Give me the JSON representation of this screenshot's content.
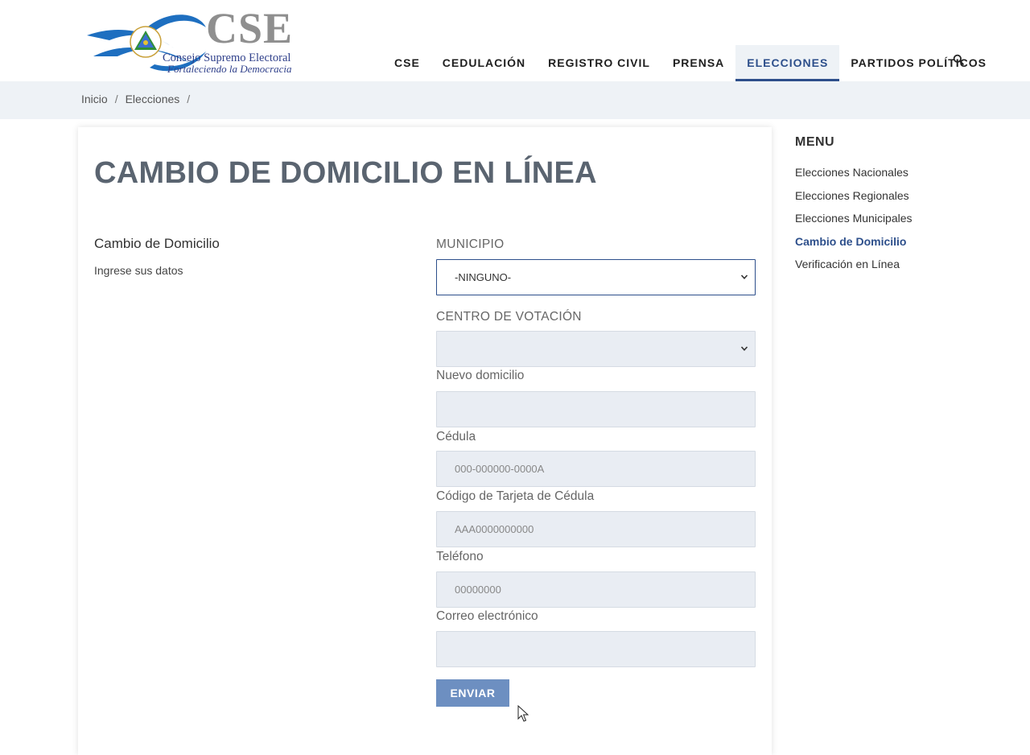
{
  "logo": {
    "title": "CSE",
    "subtitle": "Consejo Supremo Electoral",
    "tagline": "Fortaleciendo la Democracia"
  },
  "nav": {
    "items": [
      {
        "label": "CSE"
      },
      {
        "label": "CEDULACIÓN"
      },
      {
        "label": "REGISTRO CIVIL"
      },
      {
        "label": "PRENSA"
      },
      {
        "label": "ELECCIONES"
      },
      {
        "label": "PARTIDOS POLÍTICOS"
      }
    ],
    "active": "ELECCIONES",
    "search_icon": "search-icon"
  },
  "breadcrumb": {
    "items": [
      "Inicio",
      "Elecciones"
    ],
    "separator": "/"
  },
  "main": {
    "title": "CAMBIO DE DOMICILIO EN LÍNEA",
    "section_title": "Cambio de Domicilio",
    "section_subtitle": "Ingrese sus datos"
  },
  "form": {
    "municipio": {
      "label": "MUNICIPIO",
      "value": "-NINGUNO-"
    },
    "centro": {
      "label": "CENTRO DE VOTACIÓN",
      "value": ""
    },
    "domicilio": {
      "label": "Nuevo domicilio",
      "placeholder": ""
    },
    "cedula": {
      "label": "Cédula",
      "placeholder": "000-000000-0000A"
    },
    "codigo": {
      "label": "Código de Tarjeta de Cédula",
      "placeholder": "AAA0000000000"
    },
    "telefono": {
      "label": "Teléfono",
      "placeholder": "00000000"
    },
    "correo": {
      "label": "Correo electrónico",
      "placeholder": ""
    },
    "submit_label": "ENVIAR"
  },
  "sidebar": {
    "title": "MENU",
    "items": [
      {
        "label": "Elecciones Nacionales"
      },
      {
        "label": "Elecciones Regionales"
      },
      {
        "label": "Elecciones Municipales"
      },
      {
        "label": "Cambio de Domicilio"
      },
      {
        "label": "Verificación en Línea"
      }
    ],
    "active": "Cambio de Domicilio"
  },
  "colors": {
    "brand_blue": "#2d4f8b",
    "button_blue": "#6d8fc1",
    "field_bg": "#e9edf3",
    "bar_bg": "#eef2f6"
  }
}
